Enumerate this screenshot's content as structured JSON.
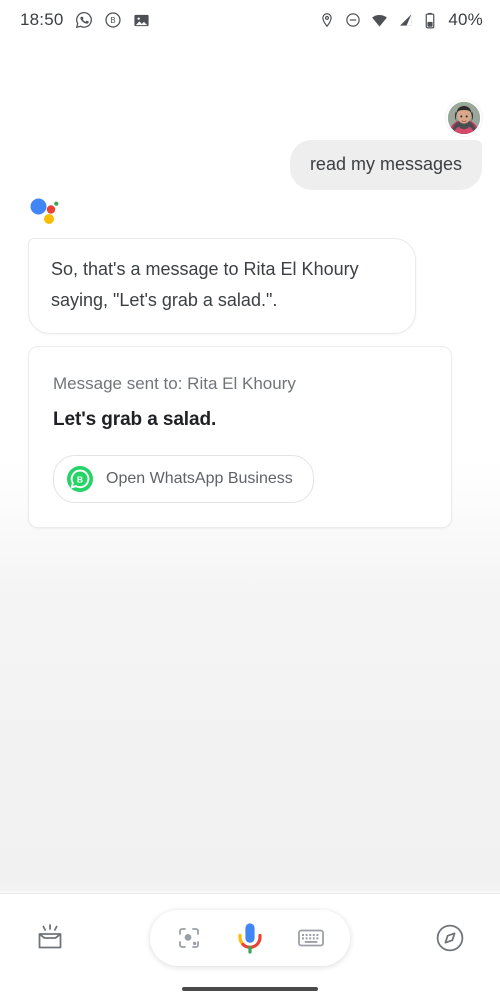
{
  "status_bar": {
    "time": "18:50",
    "battery_percent": "40%",
    "left_icons": [
      "whatsapp-icon",
      "whatsapp-business-icon",
      "photo-icon"
    ],
    "right_icons": [
      "location-pin-icon",
      "do-not-disturb-icon",
      "wifi-icon",
      "cellular-signal-icon",
      "battery-icon"
    ]
  },
  "conversation": {
    "user": {
      "avatar_name": "user-avatar",
      "message": "read my messages"
    },
    "assistant": {
      "logo_name": "google-assistant-logo",
      "message": "So, that's a message to Rita El Khoury saying, \"Let's grab a salad.\"."
    },
    "message_card": {
      "sent_to_label": "Message sent to: Rita El Khoury",
      "message_body": "Let's grab a salad.",
      "action_chip": {
        "icon_name": "whatsapp-business-icon",
        "label": "Open WhatsApp Business"
      }
    }
  },
  "bottom_bar": {
    "snapshot_icon": "snapshot-icon",
    "lens_button": "google-lens-icon",
    "mic_button": "google-mic-icon",
    "keyboard_button": "keyboard-icon",
    "explore_icon": "compass-explore-icon"
  },
  "colors": {
    "google_blue": "#4285F4",
    "google_red": "#EA4335",
    "google_yellow": "#FBBC05",
    "google_green": "#34A853",
    "whatsapp_green": "#25D366",
    "bubble_gray": "#EEEEEE",
    "text_primary": "#202124",
    "text_secondary": "#70757a"
  }
}
